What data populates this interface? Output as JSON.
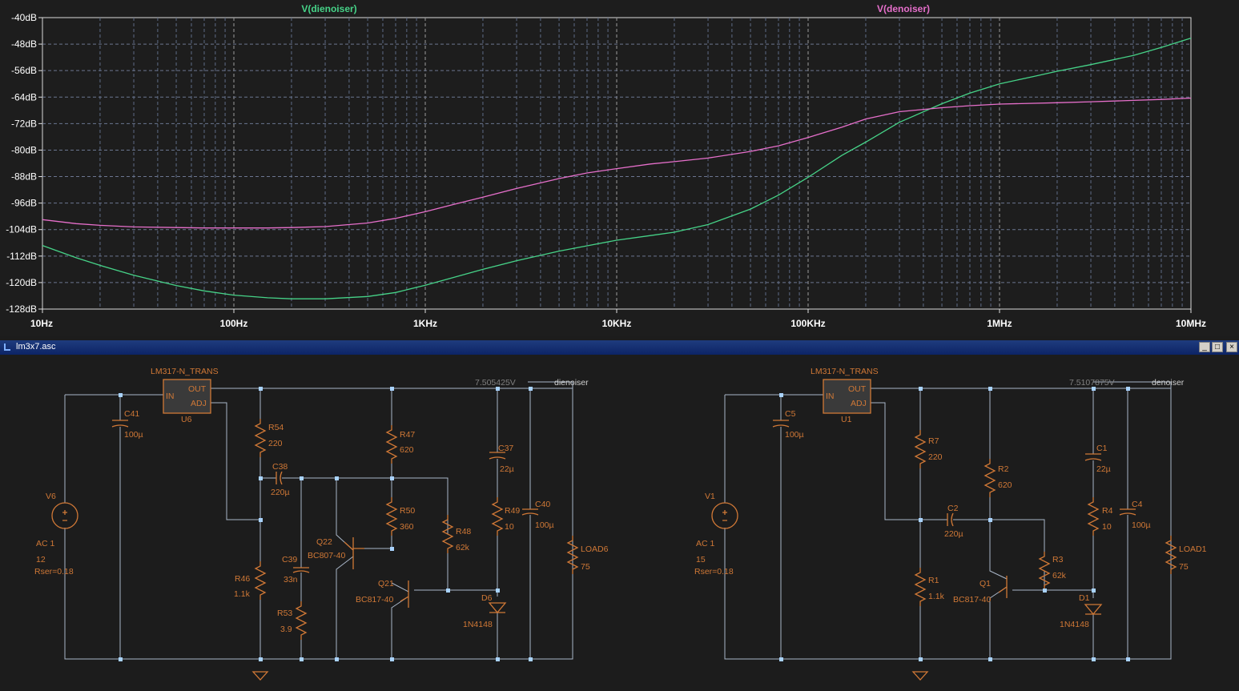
{
  "window": {
    "title": "lm3x7.asc",
    "minimize_label": "_",
    "maximize_label": "□",
    "close_label": "×"
  },
  "chart_data": {
    "type": "line",
    "x_scale": "log",
    "xlim": [
      10,
      10000000
    ],
    "ylim": [
      -128,
      -40
    ],
    "y_ticks": [
      -40,
      -48,
      -56,
      -64,
      -72,
      -80,
      -88,
      -96,
      -104,
      -112,
      -120,
      -128
    ],
    "y_tick_labels": [
      "-40dB",
      "-48dB",
      "-56dB",
      "-64dB",
      "-72dB",
      "-80dB",
      "-88dB",
      "-96dB",
      "-104dB",
      "-112dB",
      "-120dB",
      "-128dB"
    ],
    "x_ticks": [
      10,
      100,
      1000,
      10000,
      100000,
      1000000,
      10000000
    ],
    "x_tick_labels": [
      "10Hz",
      "100Hz",
      "1KHz",
      "10KHz",
      "100KHz",
      "1MHz",
      "10MHz"
    ],
    "grid": true,
    "series": [
      {
        "name": "V(dienoiser)",
        "color": "#46d388",
        "x": [
          10,
          15,
          20,
          30,
          50,
          70,
          100,
          150,
          200,
          300,
          500,
          700,
          1000,
          1500,
          2000,
          3000,
          5000,
          7000,
          10000,
          15000,
          20000,
          30000,
          50000,
          70000,
          100000,
          150000,
          200000,
          300000,
          500000,
          700000,
          1000000,
          1500000,
          2000000,
          3000000,
          5000000,
          7000000,
          10000000
        ],
        "y": [
          -108.8,
          -112.5,
          -114.8,
          -117.8,
          -120.9,
          -122.5,
          -123.8,
          -124.6,
          -124.9,
          -124.9,
          -124.2,
          -123.0,
          -120.8,
          -118.0,
          -116.0,
          -113.4,
          -110.5,
          -108.9,
          -107.2,
          -105.8,
          -104.8,
          -102.5,
          -97.8,
          -93.6,
          -88.2,
          -81.6,
          -77.6,
          -71.6,
          -66.0,
          -62.8,
          -60.0,
          -57.8,
          -56.2,
          -54.2,
          -51.4,
          -49.0,
          -46.2
        ]
      },
      {
        "name": "V(denoiser)",
        "color": "#e66fcb",
        "x": [
          10,
          15,
          20,
          30,
          50,
          70,
          100,
          150,
          200,
          300,
          500,
          700,
          1000,
          1500,
          2000,
          3000,
          5000,
          7000,
          10000,
          15000,
          20000,
          30000,
          50000,
          70000,
          100000,
          150000,
          200000,
          300000,
          500000,
          700000,
          1000000,
          2000000,
          3000000,
          5000000,
          7000000,
          10000000
        ],
        "y": [
          -101.0,
          -102.2,
          -102.7,
          -103.2,
          -103.4,
          -103.5,
          -103.5,
          -103.5,
          -103.4,
          -103.1,
          -102.0,
          -100.6,
          -98.6,
          -96.0,
          -94.2,
          -91.6,
          -88.6,
          -86.9,
          -85.6,
          -84.2,
          -83.5,
          -82.4,
          -80.4,
          -78.7,
          -76.2,
          -73.1,
          -70.6,
          -68.4,
          -67.2,
          -66.6,
          -66.1,
          -65.7,
          -65.4,
          -65.0,
          -64.7,
          -64.3
        ]
      }
    ]
  },
  "schematic": {
    "left": {
      "regulator": "LM317-N_TRANS",
      "regulator_ref": "U6",
      "pin_in": "IN",
      "pin_out": "OUT",
      "pin_adj": "ADJ",
      "voltage": "7.505425V",
      "net": "dienoiser",
      "source_ref": "V6",
      "source_ac": "AC 1",
      "source_dc": "12",
      "source_rser": "Rser=0.18",
      "c41": "C41",
      "c41_val": "100µ",
      "r54": "R54",
      "r54_val": "220",
      "c38": "C38",
      "c38_val": "220µ",
      "r47": "R47",
      "r47_val": "620",
      "c37": "C37",
      "c37_val": "22µ",
      "r50": "R50",
      "r50_val": "360",
      "r48": "R48",
      "r48_val": "62k",
      "r49": "R49",
      "r49_val": "10",
      "c40": "C40",
      "c40_val": "100µ",
      "load": "LOAD6",
      "load_val": "75",
      "q22": "Q22",
      "q22_model": "BC807-40",
      "c39": "C39",
      "c39_val": "33n",
      "r46": "R46",
      "r46_val": "1.1k",
      "q21": "Q21",
      "q21_model": "BC817-40",
      "d6": "D6",
      "d6_model": "1N4148",
      "r53": "R53",
      "r53_val": "3.9"
    },
    "right": {
      "regulator": "LM317-N_TRANS",
      "regulator_ref": "U1",
      "pin_in": "IN",
      "pin_out": "OUT",
      "pin_adj": "ADJ",
      "voltage": "7.5107875V",
      "net": "denoiser",
      "source_ref": "V1",
      "source_ac": "AC 1",
      "source_dc": "15",
      "source_rser": "Rser=0.18",
      "c5": "C5",
      "c5_val": "100µ",
      "r7": "R7",
      "r7_val": "220",
      "r2": "R2",
      "r2_val": "620",
      "c1": "C1",
      "c1_val": "22µ",
      "c2": "C2",
      "c2_val": "220µ",
      "r4": "R4",
      "r4_val": "10",
      "c4": "C4",
      "c4_val": "100µ",
      "load": "LOAD1",
      "load_val": "75",
      "r3": "R3",
      "r3_val": "62k",
      "r1": "R1",
      "r1_val": "1.1k",
      "q1": "Q1",
      "q1_model": "BC817-40",
      "d1": "D1",
      "d1_model": "1N4148"
    }
  }
}
